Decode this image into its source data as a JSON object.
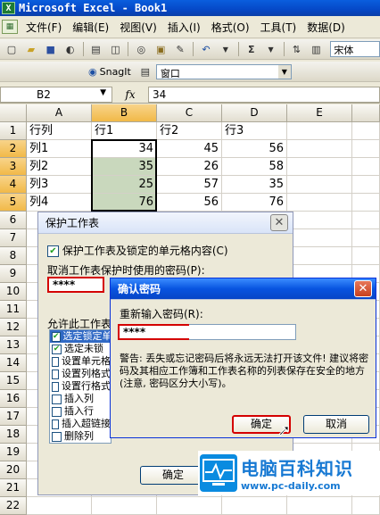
{
  "titlebar": {
    "title": "Microsoft Excel - Book1"
  },
  "menu": [
    "文件(F)",
    "编辑(E)",
    "视图(V)",
    "插入(I)",
    "格式(O)",
    "工具(T)",
    "数据(D)"
  ],
  "toolbar": {
    "font_name": "宋体",
    "sum_label": "Σ"
  },
  "snagit_toolbar": {
    "snagit_label": "SnagIt",
    "window_label": "窗口"
  },
  "formula_bar": {
    "cell_ref": "B2",
    "fx": "fx",
    "value": "34"
  },
  "sheet": {
    "columns": [
      "A",
      "B",
      "C",
      "D",
      "E"
    ],
    "rows": [
      "1",
      "2",
      "3",
      "4",
      "5",
      "6",
      "7",
      "8",
      "9",
      "10",
      "11",
      "12",
      "13",
      "14",
      "15",
      "16",
      "17",
      "18",
      "19",
      "20",
      "21",
      "22"
    ],
    "cells": [
      [
        "行列",
        "行1",
        "行2",
        "行3"
      ],
      [
        "列1",
        "34",
        "45",
        "56"
      ],
      [
        "列2",
        "35",
        "26",
        "58"
      ],
      [
        "列3",
        "25",
        "57",
        "35"
      ],
      [
        "列4",
        "76",
        "56",
        "76"
      ]
    ]
  },
  "protect_dialog": {
    "title": "保护工作表",
    "protect_check_label": "保护工作表及锁定的单元格内容(C)",
    "password_label": "取消工作表保护时使用的密码(P):",
    "password_value": "****",
    "allow_label": "允许此工作表",
    "permissions": [
      "选定锁定单",
      "选定未锁",
      "设置单元格",
      "设置列格式",
      "设置行格式",
      "插入列",
      "插入行",
      "插入超链接",
      "删除列"
    ],
    "ok_label": "确定"
  },
  "confirm_dialog": {
    "title": "确认密码",
    "reenter_label": "重新输入密码(R):",
    "password_value": "****",
    "warning": "警告: 丢失或忘记密码后将永远无法打开该文件! 建议将密码及其相应工作簿和工作表名称的列表保存在安全的地方(注意, 密码区分大小写)。",
    "ok_label": "确定",
    "cancel_label": "取消"
  },
  "watermark": {
    "brand": "电脑百科知识",
    "url": "www.pc-daily.com"
  }
}
